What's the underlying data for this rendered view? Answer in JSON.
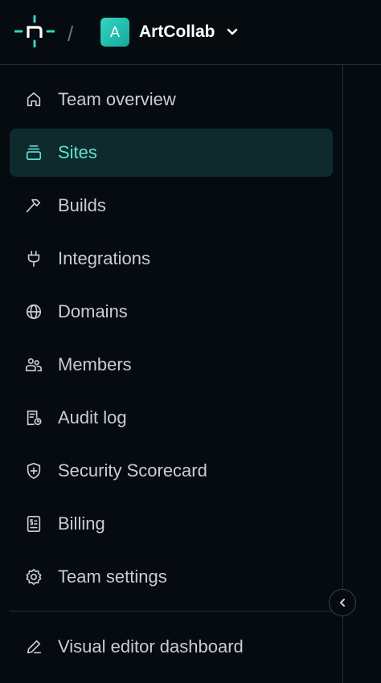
{
  "header": {
    "logo_icon": "netlify-logo-icon",
    "separator": "/",
    "team_avatar_letter": "A",
    "team_name": "ArtCollab",
    "accent_color": "#2fd7c4"
  },
  "nav": {
    "items": [
      {
        "label": "Team overview",
        "icon": "home-icon"
      },
      {
        "label": "Sites",
        "icon": "layers-icon",
        "active": true
      },
      {
        "label": "Builds",
        "icon": "hammer-icon"
      },
      {
        "label": "Integrations",
        "icon": "plug-icon"
      },
      {
        "label": "Domains",
        "icon": "globe-icon"
      },
      {
        "label": "Members",
        "icon": "users-icon"
      },
      {
        "label": "Audit log",
        "icon": "audit-log-icon"
      },
      {
        "label": "Security Scorecard",
        "icon": "shield-icon"
      },
      {
        "label": "Billing",
        "icon": "receipt-icon"
      },
      {
        "label": "Team settings",
        "icon": "gear-icon"
      }
    ],
    "bottom_item": {
      "label": "Visual editor dashboard",
      "icon": "pencil-icon"
    },
    "active_color": "#5fe3d4"
  }
}
